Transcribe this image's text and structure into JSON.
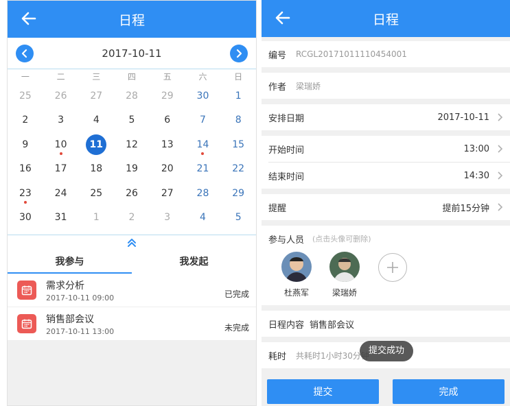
{
  "left": {
    "header": {
      "title": "日程"
    },
    "calendar": {
      "month_title": "2017-10-11",
      "weekdays": [
        "一",
        "二",
        "三",
        "四",
        "五",
        "六",
        "日"
      ],
      "weeks": [
        [
          "25",
          "26",
          "27",
          "28",
          "29",
          "30",
          "1"
        ],
        [
          "2",
          "3",
          "4",
          "5",
          "6",
          "7",
          "8"
        ],
        [
          "9",
          "10",
          "11",
          "12",
          "13",
          "14",
          "15"
        ],
        [
          "16",
          "17",
          "18",
          "19",
          "20",
          "21",
          "22"
        ],
        [
          "23",
          "24",
          "25",
          "26",
          "27",
          "28",
          "29"
        ],
        [
          "30",
          "31",
          "1",
          "2",
          "3",
          "4",
          "5"
        ]
      ],
      "selected_day": "11",
      "event_dot_color": "#e14a3b"
    },
    "tabs": [
      {
        "label": "我参与",
        "active": true
      },
      {
        "label": "我发起",
        "active": false
      }
    ],
    "schedules": [
      {
        "title": "需求分析",
        "time": "2017-10-11 09:00",
        "status": "已完成"
      },
      {
        "title": "销售部会议",
        "time": "2017-10-11 13:00",
        "status": "未完成"
      }
    ]
  },
  "right": {
    "header": {
      "title": "日程"
    },
    "fields": {
      "code": {
        "label": "编号",
        "value": "RCGL20171011110454001"
      },
      "author": {
        "label": "作者",
        "value": "梁瑞娇"
      },
      "date": {
        "label": "安排日期",
        "value": "2017-10-11"
      },
      "start": {
        "label": "开始时间",
        "value": "13:00"
      },
      "end": {
        "label": "结束时间",
        "value": "14:30"
      },
      "remind": {
        "label": "提醒",
        "value": "提前15分钟"
      },
      "participants": {
        "label": "参与人员",
        "hint": "(点击头像可删除)"
      },
      "content": {
        "label": "日程内容",
        "value": "销售部会议"
      },
      "duration": {
        "label": "耗时",
        "value": "共耗时1小时30分钟"
      }
    },
    "participants": [
      {
        "name": "杜燕军"
      },
      {
        "name": "梁瑞娇"
      }
    ],
    "toast": "提交成功",
    "buttons": {
      "submit": "提交",
      "done": "完成"
    }
  },
  "colors": {
    "primary": "#2f8ef3",
    "selected_day": "#1f6fd4",
    "weekend_text": "#3a74b9",
    "event_icon": "#ec5a56"
  }
}
